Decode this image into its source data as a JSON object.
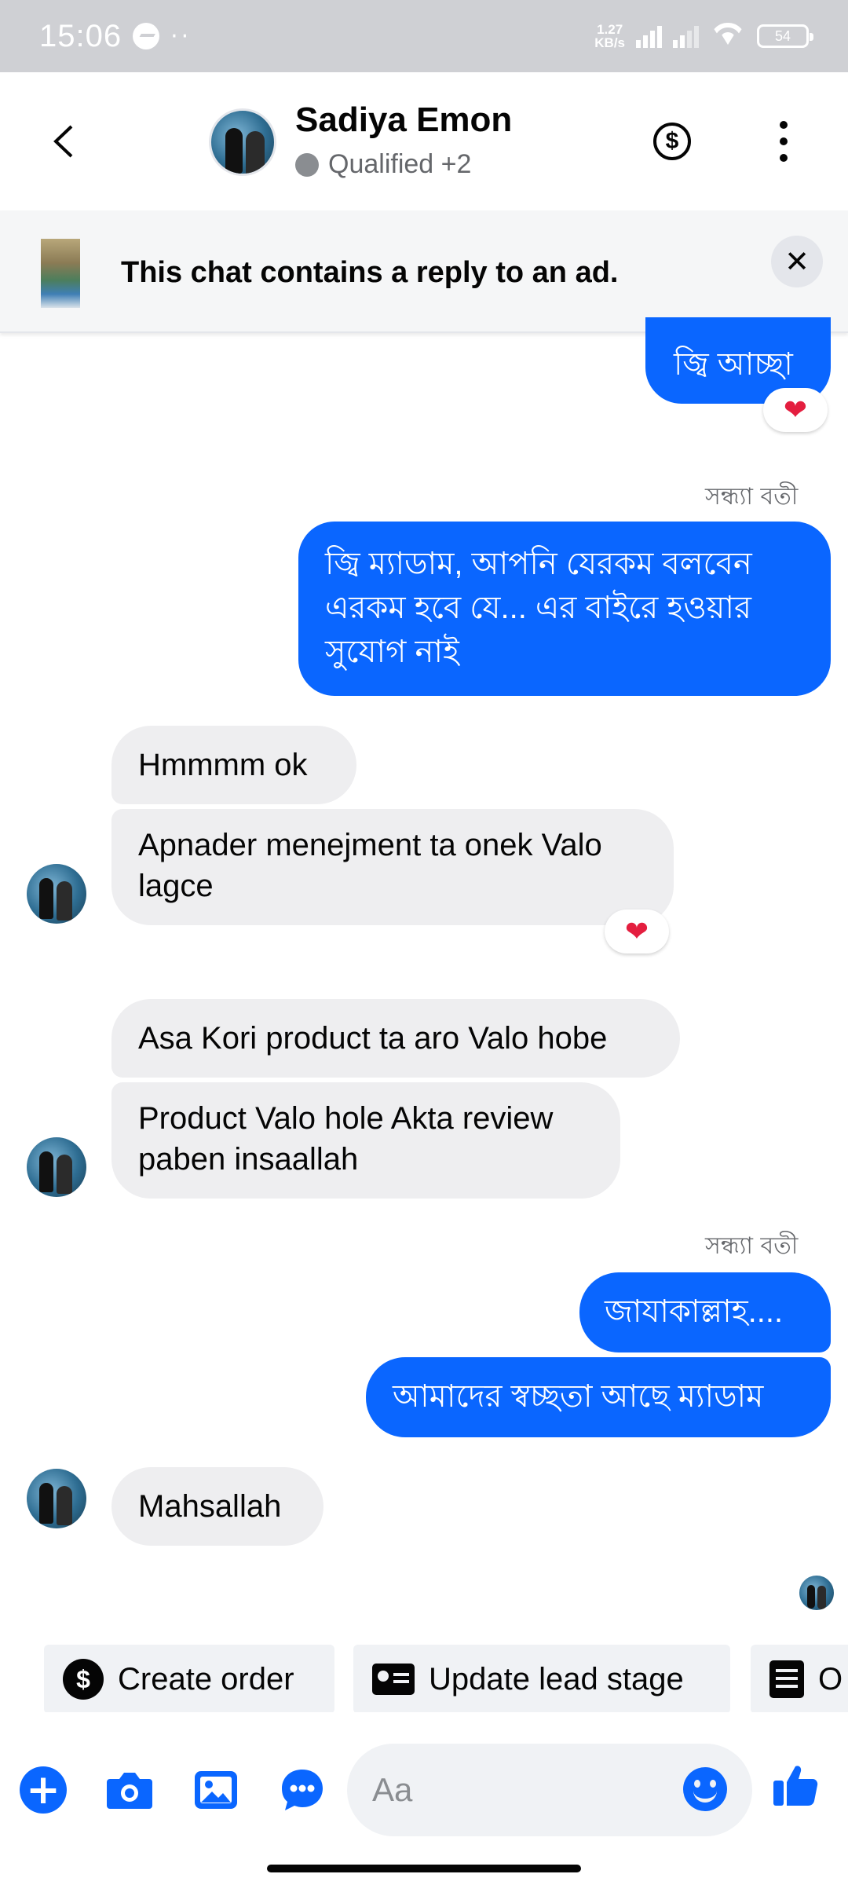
{
  "status_bar": {
    "time": "15:06",
    "network_speed_value": "1.27",
    "network_speed_unit": "KB/s",
    "battery": "54",
    "overflow_dots": "··"
  },
  "header": {
    "contact_name": "Sadiya Emon",
    "contact_status": "Qualified +2",
    "back_icon": "chevron-left-icon",
    "payment_icon": "dollar-circle-icon",
    "more_icon": "more-vertical-icon",
    "payment_symbol": "$"
  },
  "ad_banner": {
    "text": "This chat contains a reply to an ad.",
    "close_symbol": "✕"
  },
  "messages": [
    {
      "direction": "outgoing",
      "text": "জ্বি আচ্ছা",
      "reaction": "❤"
    },
    {
      "direction": "outgoing",
      "sender": "সন্ধ্যা বতী",
      "text_lines": [
        "জ্বি ম্যাডাম, আপনি যেরকম বলবেন",
        "এরকম হবে যে... এর বাইরে হওয়ার",
        "সুযোগ নাই"
      ]
    },
    {
      "direction": "incoming",
      "text": "Hmmmm ok"
    },
    {
      "direction": "incoming",
      "text_lines": [
        "Apnader menejment ta onek Valo",
        "lagce"
      ],
      "reaction": "❤"
    },
    {
      "direction": "incoming",
      "text": "Asa Kori product ta aro Valo hobe"
    },
    {
      "direction": "incoming",
      "text_lines": [
        "Product Valo hole Akta review",
        "paben insaallah"
      ]
    },
    {
      "direction": "outgoing",
      "sender": "সন্ধ্যা বতী",
      "text": "জাযাকাল্লাহ...."
    },
    {
      "direction": "outgoing",
      "text": "আমাদের স্বচ্ছতা আছে ম্যাডাম"
    },
    {
      "direction": "incoming",
      "text": "Mahsallah"
    }
  ],
  "quick_actions": [
    {
      "label": "Create order",
      "icon": "dollar-circle-icon"
    },
    {
      "label": "Update lead stage",
      "icon": "contact-card-icon"
    },
    {
      "label": "O",
      "icon": "form-icon"
    }
  ],
  "composer": {
    "placeholder": "Aa",
    "icons": [
      "plus-icon",
      "camera-icon",
      "gallery-icon",
      "chat-bubble-icon",
      "emoji-icon",
      "thumbs-up-icon"
    ]
  },
  "colors": {
    "outgoing_bubble": "#0a66ff",
    "incoming_bubble": "#eeeef0",
    "accent": "#0a66ff",
    "reaction_heart": "#e41e3f"
  }
}
